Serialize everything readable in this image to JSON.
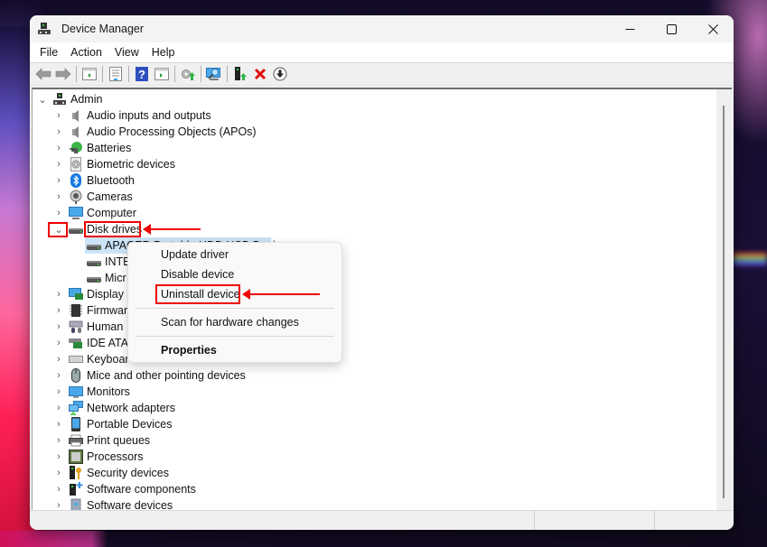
{
  "window": {
    "title": "Device Manager",
    "controls": {
      "minimize": "—",
      "maximize": "☐",
      "close": "✕"
    }
  },
  "menubar": {
    "items": [
      "File",
      "Action",
      "View",
      "Help"
    ]
  },
  "toolbar": {
    "buttons": [
      "back-icon",
      "forward-icon",
      "show-hide-console-tree-icon",
      "properties-icon",
      "help-icon",
      "show-action-pane-icon",
      "update-driver-icon",
      "scan-hardware-icon",
      "enable-device-icon",
      "uninstall-icon",
      "disable-device-icon"
    ]
  },
  "tree": {
    "root": {
      "label": "Admin",
      "expanded": true
    },
    "categories": [
      {
        "label": "Audio inputs and outputs",
        "icon": "speaker-icon"
      },
      {
        "label": "Audio Processing Objects (APOs)",
        "icon": "speaker-icon"
      },
      {
        "label": "Batteries",
        "icon": "battery-icon"
      },
      {
        "label": "Biometric devices",
        "icon": "fingerprint-icon"
      },
      {
        "label": "Bluetooth",
        "icon": "bluetooth-icon"
      },
      {
        "label": "Cameras",
        "icon": "camera-icon"
      },
      {
        "label": "Computer",
        "icon": "computer-icon"
      },
      {
        "label": "Disk drives",
        "icon": "disk-drive-icon",
        "expanded": true,
        "children": [
          {
            "label": "APACER Portable HDD USB Device",
            "selected": true
          },
          {
            "label": "INTE"
          },
          {
            "label": "Micr"
          }
        ]
      },
      {
        "label": "Display a",
        "icon": "display-adapter-icon"
      },
      {
        "label": "Firmwar",
        "icon": "firmware-icon"
      },
      {
        "label": "Human",
        "icon": "hid-icon"
      },
      {
        "label": "IDE ATA/",
        "icon": "ide-icon"
      },
      {
        "label": "Keyboar",
        "icon": "keyboard-icon"
      },
      {
        "label": "Mice and other pointing devices",
        "icon": "mouse-icon"
      },
      {
        "label": "Monitors",
        "icon": "monitor-icon"
      },
      {
        "label": "Network adapters",
        "icon": "network-icon"
      },
      {
        "label": "Portable Devices",
        "icon": "portable-device-icon"
      },
      {
        "label": "Print queues",
        "icon": "printer-icon"
      },
      {
        "label": "Processors",
        "icon": "processor-icon"
      },
      {
        "label": "Security devices",
        "icon": "security-icon"
      },
      {
        "label": "Software components",
        "icon": "software-component-icon"
      },
      {
        "label": "Software devices",
        "icon": "software-device-icon"
      }
    ]
  },
  "context_menu": {
    "items": [
      {
        "label": "Update driver"
      },
      {
        "label": "Disable device"
      },
      {
        "label": "Uninstall device",
        "highlighted": true
      },
      {
        "label": "Scan for hardware changes"
      },
      {
        "label": "Properties",
        "bold": true
      }
    ]
  },
  "annotations": {
    "color": "#ee0000"
  }
}
